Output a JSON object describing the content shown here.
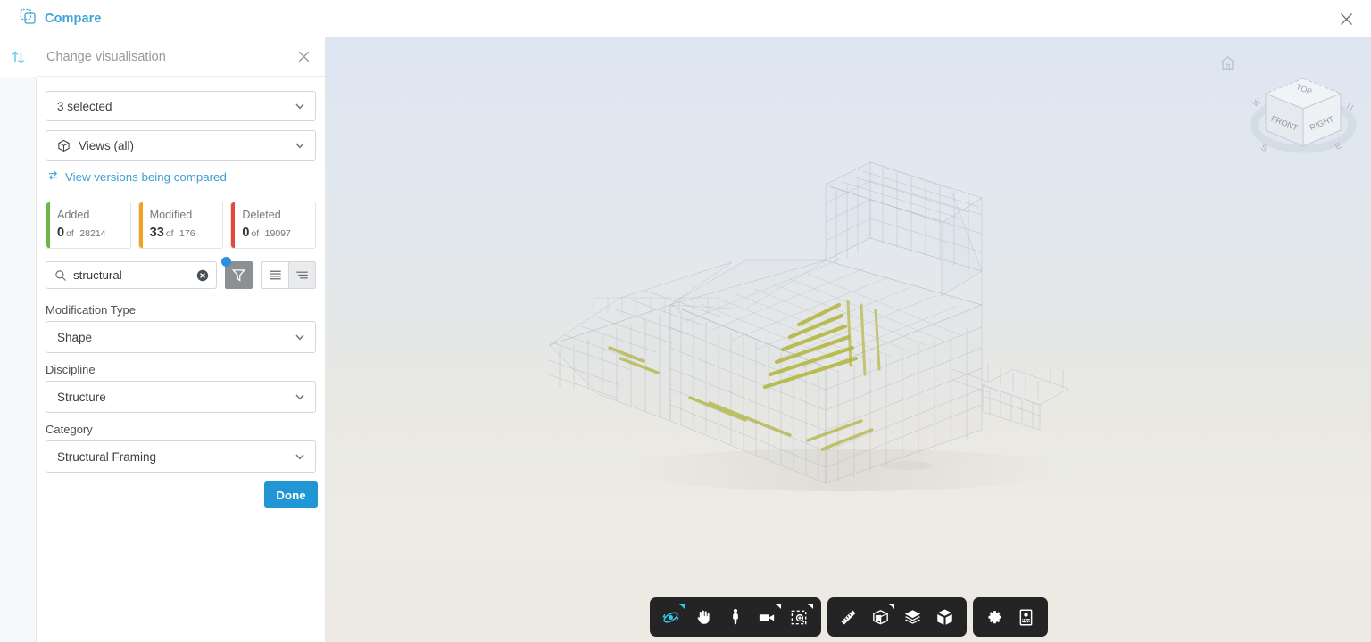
{
  "topbar": {
    "brand_label": "Compare",
    "brand_icon": "compare-icon",
    "close_icon": "close-icon",
    "accent_color": "#3da4d4"
  },
  "rail": {
    "swap_icon": "arrows-up-down-icon"
  },
  "panel": {
    "title": "Change visualisation",
    "close_icon": "close-icon",
    "models_select": {
      "value": "3 selected",
      "icon": "chevron-down-icon"
    },
    "views_select": {
      "value": "Views (all)",
      "icon": "cube-icon",
      "chevron": "chevron-down-icon"
    },
    "versions_link": {
      "label": "View versions being compared",
      "icon": "compare-arrows-icon"
    },
    "stats": [
      {
        "name": "Added",
        "count": "0",
        "of_label": "of",
        "total": "28214",
        "color": "#6cb744"
      },
      {
        "name": "Modified",
        "count": "33",
        "of_label": "of",
        "total": "176",
        "color": "#f4a21b"
      },
      {
        "name": "Deleted",
        "count": "0",
        "of_label": "of",
        "total": "19097",
        "color": "#e8453c"
      }
    ],
    "search": {
      "value": "structural",
      "placeholder": "Search",
      "search_icon": "search-icon",
      "clear_icon": "clear-circle-icon"
    },
    "filter_button": {
      "icon": "filter-funnel-icon",
      "active": true,
      "badge": true
    },
    "view_toggles": [
      {
        "icon": "list-compact-icon",
        "selected": false
      },
      {
        "icon": "list-grouped-icon",
        "selected": true
      }
    ],
    "fields": [
      {
        "label": "Modification Type",
        "value": "Shape"
      },
      {
        "label": "Discipline",
        "value": "Structure"
      },
      {
        "label": "Category",
        "value": "Structural Framing"
      }
    ],
    "done_button": "Done"
  },
  "viewport": {
    "home_icon": "home-icon",
    "viewcube": {
      "top_face": "TOP",
      "front_face": "FRONT",
      "right_face": "RIGHT",
      "compass": {
        "north": "N",
        "east": "E",
        "south": "S",
        "west": "W"
      }
    },
    "background_top_color": "#dee6f2",
    "background_bottom_color": "#edeae4",
    "highlight_color": "#b3b53a"
  },
  "toolbar": {
    "groups": [
      {
        "buttons": [
          {
            "icon": "orbit-icon",
            "active": true,
            "corner": true
          },
          {
            "icon": "pan-hand-icon",
            "active": false,
            "corner": false
          },
          {
            "icon": "walk-person-icon",
            "active": false,
            "corner": false
          },
          {
            "icon": "camera-icon",
            "active": false,
            "corner": true
          },
          {
            "icon": "zoom-window-icon",
            "active": false,
            "corner": true
          }
        ]
      },
      {
        "buttons": [
          {
            "icon": "measure-ruler-icon",
            "active": false,
            "corner": false
          },
          {
            "icon": "section-box-icon",
            "active": false,
            "corner": true
          },
          {
            "icon": "layers-icon",
            "active": false,
            "corner": false
          },
          {
            "icon": "model-cube-icon",
            "active": false,
            "corner": false
          }
        ]
      },
      {
        "buttons": [
          {
            "icon": "settings-gear-icon",
            "active": false,
            "corner": false
          },
          {
            "icon": "properties-panel-icon",
            "active": false,
            "corner": false
          }
        ]
      }
    ]
  }
}
